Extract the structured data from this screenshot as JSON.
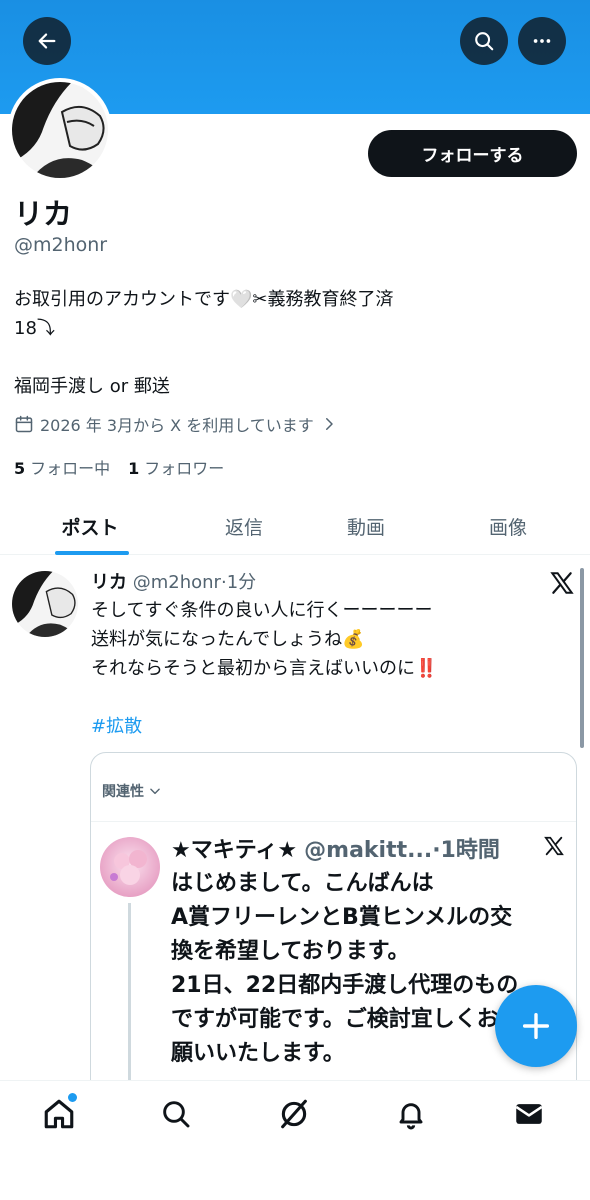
{
  "colors": {
    "accent": "#1d9bf0",
    "text": "#0f1419",
    "secondary": "#536471",
    "alert": "#f4212e"
  },
  "profile": {
    "display_name": "リカ",
    "handle": "@m2honr",
    "follow_label": "フォローする",
    "bio_lines": [
      "お取引用のアカウントです🤍✂︎義務教育終了済",
      "18⤵︎",
      "",
      "福岡手渡し or 郵送"
    ],
    "joined": "2026 年 3月から X を利用しています",
    "following_count": "5",
    "following_label": "フォロー中",
    "followers_count": "1",
    "followers_label": "フォロワー"
  },
  "tabs": [
    {
      "label": "ポスト",
      "active": true
    },
    {
      "label": "返信",
      "active": false
    },
    {
      "label": "動画",
      "active": false
    },
    {
      "label": "画像",
      "active": false
    }
  ],
  "post": {
    "author": "リカ",
    "handle": "@m2honr",
    "time": "1分",
    "lines": [
      "そしてすぐ条件の良い人に行くーーーーー",
      "送料が気になったんでしょうね💰",
      "それならそうと最初から言えばいいのに‼️",
      ""
    ],
    "hashtag": "#拡散"
  },
  "reply_card": {
    "relevance_label": "関連性",
    "author": "★マキティ★",
    "handle": "@makitt...",
    "time": "1時間",
    "text_lines": [
      "はじめまして。こんばんは",
      "A賞フリーレンとB賞ヒンメルの交",
      "換を希望しております。",
      "21日、22日都内手渡し代理のもの",
      "ですが可能です。ご検討宜しくお",
      "願いいたします。"
    ]
  },
  "icons": {
    "back": "arrow-left-icon",
    "search": "search-icon",
    "more": "more-horizontal-icon",
    "calendar": "calendar-icon",
    "x_logo": "x-logo-icon",
    "compose": "plus-icon",
    "nav": [
      "home-icon",
      "search-icon",
      "grok-icon",
      "bell-icon",
      "mail-icon"
    ]
  }
}
